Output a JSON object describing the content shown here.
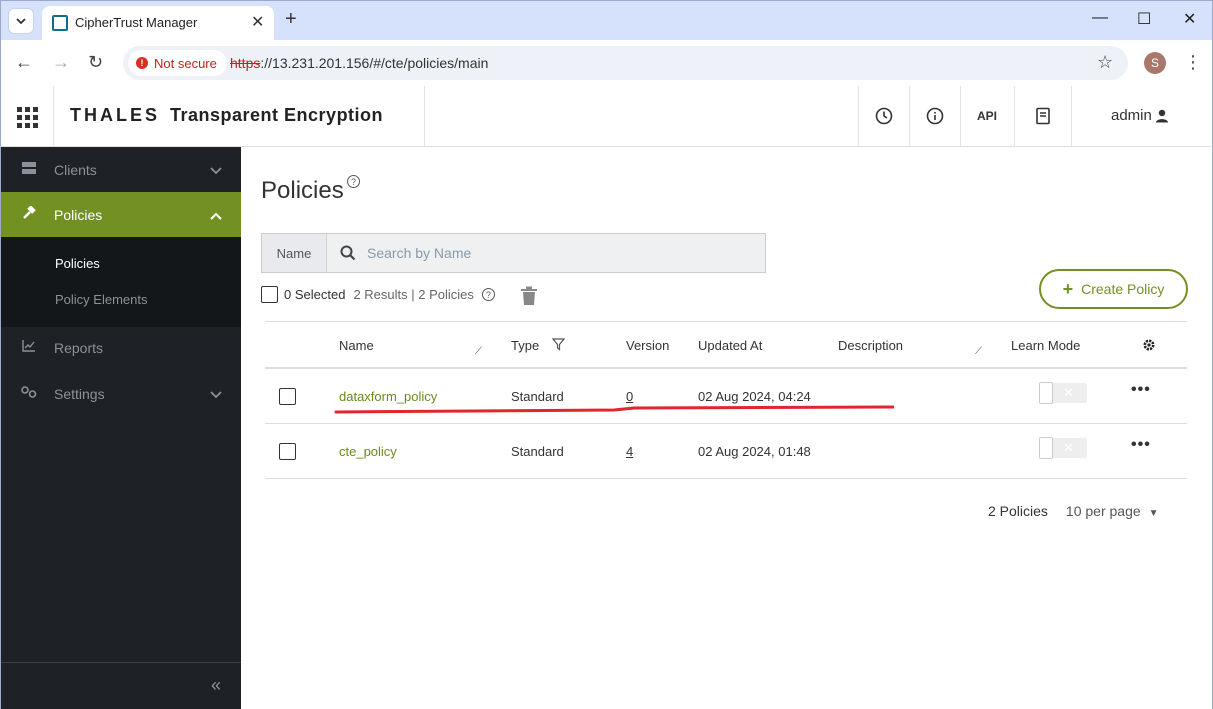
{
  "browser": {
    "tab_title": "CipherTrust Manager",
    "address": {
      "security_label": "Not secure",
      "url_scheme": "https",
      "url_rest": "://13.231.201.156/#/cte/policies/main"
    },
    "profile_initial": "S"
  },
  "header": {
    "brand_logo": "THALES",
    "brand_product": "Transparent Encryption",
    "api_label": "API",
    "user_label": "admin"
  },
  "sidebar": {
    "items": [
      {
        "label": "Clients",
        "icon": "server-icon"
      },
      {
        "label": "Policies",
        "icon": "hammer-icon"
      },
      {
        "label": "Reports",
        "icon": "chart-icon"
      },
      {
        "label": "Settings",
        "icon": "gears-icon"
      }
    ],
    "sub_items": [
      {
        "label": "Policies"
      },
      {
        "label": "Policy Elements"
      }
    ]
  },
  "main": {
    "title": "Policies",
    "search": {
      "label": "Name",
      "placeholder": "Search by Name"
    },
    "selection": {
      "selected": "0 Selected",
      "results": "2 Results | 2 Policies"
    },
    "create_button": "Create Policy",
    "table": {
      "columns": [
        "Name",
        "Type",
        "Version",
        "Updated At",
        "Description",
        "Learn Mode"
      ],
      "rows": [
        {
          "name": "dataxform_policy",
          "type": "Standard",
          "version": "0",
          "updated_at": "02 Aug 2024, 04:24",
          "description": "",
          "learn_mode": false
        },
        {
          "name": "cte_policy",
          "type": "Standard",
          "version": "4",
          "updated_at": "02 Aug 2024, 01:48",
          "description": "",
          "learn_mode": false
        }
      ]
    },
    "pager": {
      "count": "2 Policies",
      "per_page": "10 per page"
    }
  },
  "colors": {
    "accent": "#739123",
    "sidebar_bg": "#1e2226",
    "annotation": "#e0262f"
  }
}
